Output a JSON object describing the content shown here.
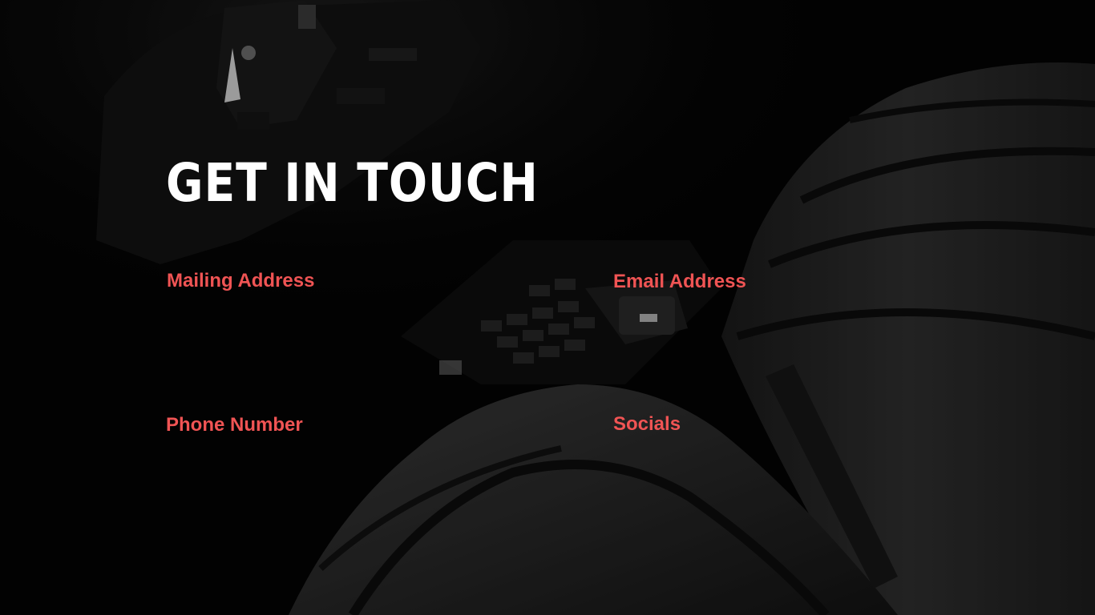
{
  "slide": {
    "title": "GET IN TOUCH",
    "background_image": "car-interior-seats-photo",
    "accent_color": "#f05454",
    "title_color": "#ffffff",
    "background_color": "#030303"
  },
  "contact": {
    "mailing": {
      "label": "Mailing Address",
      "value": ""
    },
    "email": {
      "label": "Email Address",
      "value": ""
    },
    "phone": {
      "label": "Phone Number",
      "value": ""
    },
    "socials": {
      "label": "Socials",
      "value": ""
    }
  }
}
